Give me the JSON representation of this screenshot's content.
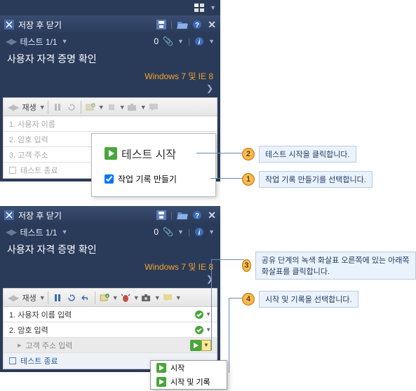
{
  "top": {
    "save_close": "저장 후 닫기",
    "test_nav": "테스트 1/1",
    "pinned_count": "0",
    "test_title": "사용자 자격 증명 확인",
    "config": "Windows 7 및 IE 8"
  },
  "toolbar": {
    "play_label": "재생"
  },
  "panel1": {
    "steps": [
      "1. 사용자 이름",
      "2. 암호 입력",
      "3. 고객 주소",
      "테스트 종료"
    ],
    "overlay": {
      "start_label": "테스트 시작",
      "checkbox_label": "작업 기록 만들기"
    }
  },
  "panel2": {
    "steps": {
      "s1": "1. 사용자 이름 입력",
      "s2": "2. 암호 입력",
      "s3_shared": "고객 주소 입력",
      "end": "테스트 종료"
    },
    "menu": {
      "start": "시작",
      "start_record": "시작 및 기록"
    }
  },
  "callouts": {
    "c1": "작업 기록 만들기를 선택합니다.",
    "c2": "테스트 시작을 클릭합니다.",
    "c3": "공유 단계의 녹색 화살표 오른쪽에 있는 아래쪽 화살표를 클릭합니다.",
    "c4": "시작 및 기록을 선택합니다."
  },
  "icons": {
    "grid": "grid-icon",
    "app": "app-icon",
    "disk": "save-icon",
    "folder": "open-icon",
    "help": "help-icon",
    "close": "close-icon",
    "clip": "paperclip-icon",
    "info": "info-icon",
    "play_sm": "play-icon",
    "green_arrow": "play-arrow-icon",
    "check": "check-icon"
  }
}
